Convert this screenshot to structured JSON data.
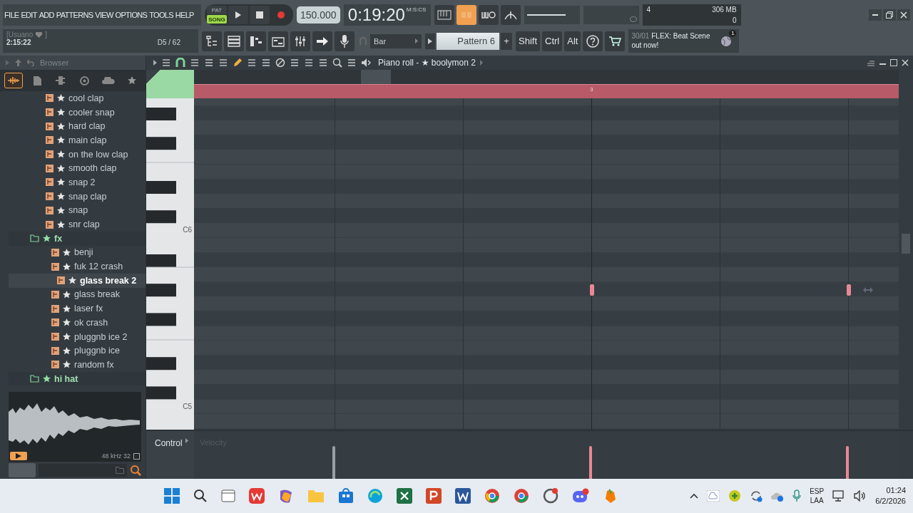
{
  "menu": [
    "FILE",
    "EDIT",
    "ADD",
    "PATTERNS",
    "VIEW",
    "OPTIONS",
    "TOOLS",
    "HELP"
  ],
  "transport": {
    "modes": [
      {
        "label": "PAT",
        "selected": false
      },
      {
        "label": "SONG",
        "selected": true
      }
    ],
    "tempo": "150.000",
    "time": "0:19:20",
    "time_unit": "M:S:CS"
  },
  "hint_panel": {
    "user": "[Usuano",
    "user_end": "]",
    "elapsed": "2:15:22",
    "note": "D5 / 62"
  },
  "snap": "Bar",
  "pattern": "Pattern 6",
  "pattern_add": "+",
  "modifiers": [
    "Shift",
    "Ctrl",
    "Alt"
  ],
  "master_volume": {
    "level": 0.78
  },
  "monitor": {
    "cpu": "4",
    "memory": "306 MB",
    "polyphony": "0"
  },
  "news": {
    "date": "30/01",
    "text": "FLEX: Beat Scene out now!",
    "badge": "1"
  },
  "browser": {
    "title": "Browser",
    "tabs": [
      {
        "kind": "all",
        "selected": true
      },
      {
        "kind": "files",
        "selected": false
      },
      {
        "kind": "plugins",
        "selected": false
      },
      {
        "kind": "globe",
        "selected": false
      },
      {
        "kind": "cloud",
        "selected": false
      },
      {
        "kind": "starred",
        "selected": false
      }
    ],
    "items": [
      {
        "kind": "file",
        "label": "cool clap",
        "selected": false
      },
      {
        "kind": "file",
        "label": "cooler snap",
        "selected": false
      },
      {
        "kind": "file",
        "label": "hard clap",
        "selected": false
      },
      {
        "kind": "file",
        "label": "main clap",
        "selected": false
      },
      {
        "kind": "file",
        "label": "on the low clap",
        "selected": false
      },
      {
        "kind": "file",
        "label": "smooth clap",
        "selected": false
      },
      {
        "kind": "file",
        "label": "snap 2",
        "selected": false
      },
      {
        "kind": "file",
        "label": "snap clap",
        "selected": false
      },
      {
        "kind": "file",
        "label": "snap",
        "selected": false
      },
      {
        "kind": "file",
        "label": "snr clap",
        "selected": false
      },
      {
        "kind": "folder",
        "label": "fx",
        "selected": false,
        "children": [
          {
            "kind": "file",
            "label": "benji",
            "selected": false
          },
          {
            "kind": "file",
            "label": "fuk 12 crash",
            "selected": false,
            "children": [
              {
                "kind": "file",
                "label": "glass break 2",
                "selected": true
              }
            ]
          },
          {
            "kind": "file",
            "label": "glass break",
            "selected": false
          },
          {
            "kind": "file",
            "label": "laser fx",
            "selected": false
          },
          {
            "kind": "file",
            "label": "ok crash",
            "selected": false
          },
          {
            "kind": "file",
            "label": "pluggnb ice 2",
            "selected": false
          },
          {
            "kind": "file",
            "label": "pluggnb ice",
            "selected": false
          },
          {
            "kind": "file",
            "label": "random fx",
            "selected": false
          }
        ]
      },
      {
        "kind": "folder",
        "label": "hi hat",
        "selected": false
      }
    ],
    "sample_info": "48 kHz 32"
  },
  "piano_roll": {
    "title": "Piano roll - ★ boolymon 2",
    "bar_marker": "3",
    "key_labels": [
      "C6",
      "C5"
    ],
    "control_label": "Control",
    "control_param": "Velocity"
  },
  "taskbar": {
    "language": [
      "ESP",
      "LAA"
    ],
    "time": "01:24",
    "date": "6/2/2026"
  }
}
